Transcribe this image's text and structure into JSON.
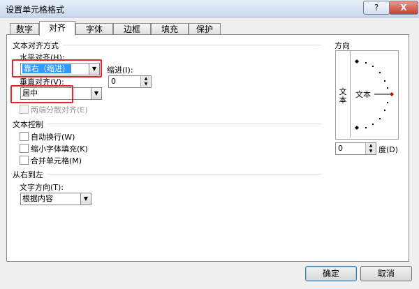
{
  "window": {
    "title": "设置单元格格式",
    "help_label": "?",
    "close_label": "X"
  },
  "tabs": [
    {
      "label": "数字",
      "active": false
    },
    {
      "label": "对齐",
      "active": true
    },
    {
      "label": "字体",
      "active": false
    },
    {
      "label": "边框",
      "active": false
    },
    {
      "label": "填充",
      "active": false
    },
    {
      "label": "保护",
      "active": false
    }
  ],
  "alignment": {
    "section_title": "文本对齐方式",
    "horizontal_label": "水平对齐(H):",
    "horizontal_value": "靠右（缩进）",
    "indent_label": "缩进(I):",
    "indent_value": "0",
    "vertical_label": "垂直对齐(V):",
    "vertical_value": "居中",
    "distributed_label": "两端分散对齐(E)"
  },
  "text_control": {
    "section_title": "文本控制",
    "wrap_label": "自动换行(W)",
    "shrink_label": "缩小字体填充(K)",
    "merge_label": "合并单元格(M)"
  },
  "rtl": {
    "section_title": "从右到左",
    "direction_label": "文字方向(T):",
    "direction_value": "根据内容"
  },
  "orientation": {
    "section_title": "方向",
    "vertical_text_char1": "文",
    "vertical_text_char2": "本",
    "horizontal_text": "文本",
    "degree_value": "0",
    "degree_label": "度(D)"
  },
  "buttons": {
    "ok": "确定",
    "cancel": "取消"
  },
  "colors": {
    "highlight_red": "#e8232a",
    "selection_blue": "#3399ff"
  }
}
